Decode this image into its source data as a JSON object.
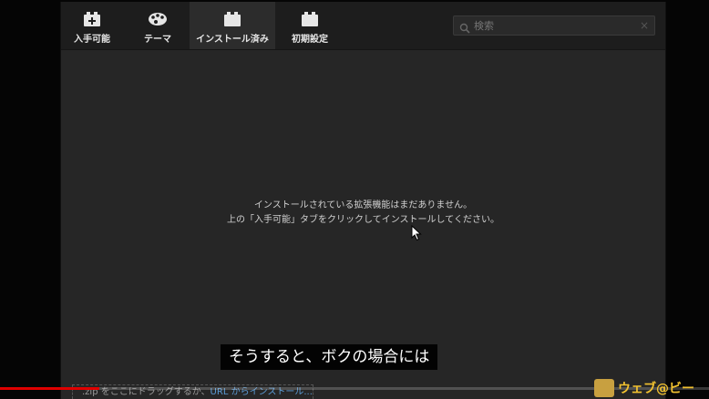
{
  "tabs": [
    {
      "label": "入手可能",
      "icon": "puzzle-plus-icon"
    },
    {
      "label": "テーマ",
      "icon": "palette-icon"
    },
    {
      "label": "インストール済み",
      "icon": "puzzle-icon",
      "active": true
    },
    {
      "label": "初期設定",
      "icon": "puzzle-icon"
    }
  ],
  "search": {
    "placeholder": "検索",
    "clear": "×"
  },
  "empty_message": {
    "line1": "インストールされている拡張機能はまだありません。",
    "line2": "上の「入手可能」タブをクリックしてインストールしてください。"
  },
  "drop_bar": {
    "text": ".zip をここにドラッグするか、",
    "link": "URL からインストール..."
  },
  "caption": "そうすると、ボクの場合には",
  "progress": {
    "fraction": 0.14
  },
  "logo": {
    "name": "ウェブ@ビー"
  },
  "colors": {
    "accent": "#e00000",
    "link": "#5b9bd5",
    "logo": "#f2c230"
  }
}
